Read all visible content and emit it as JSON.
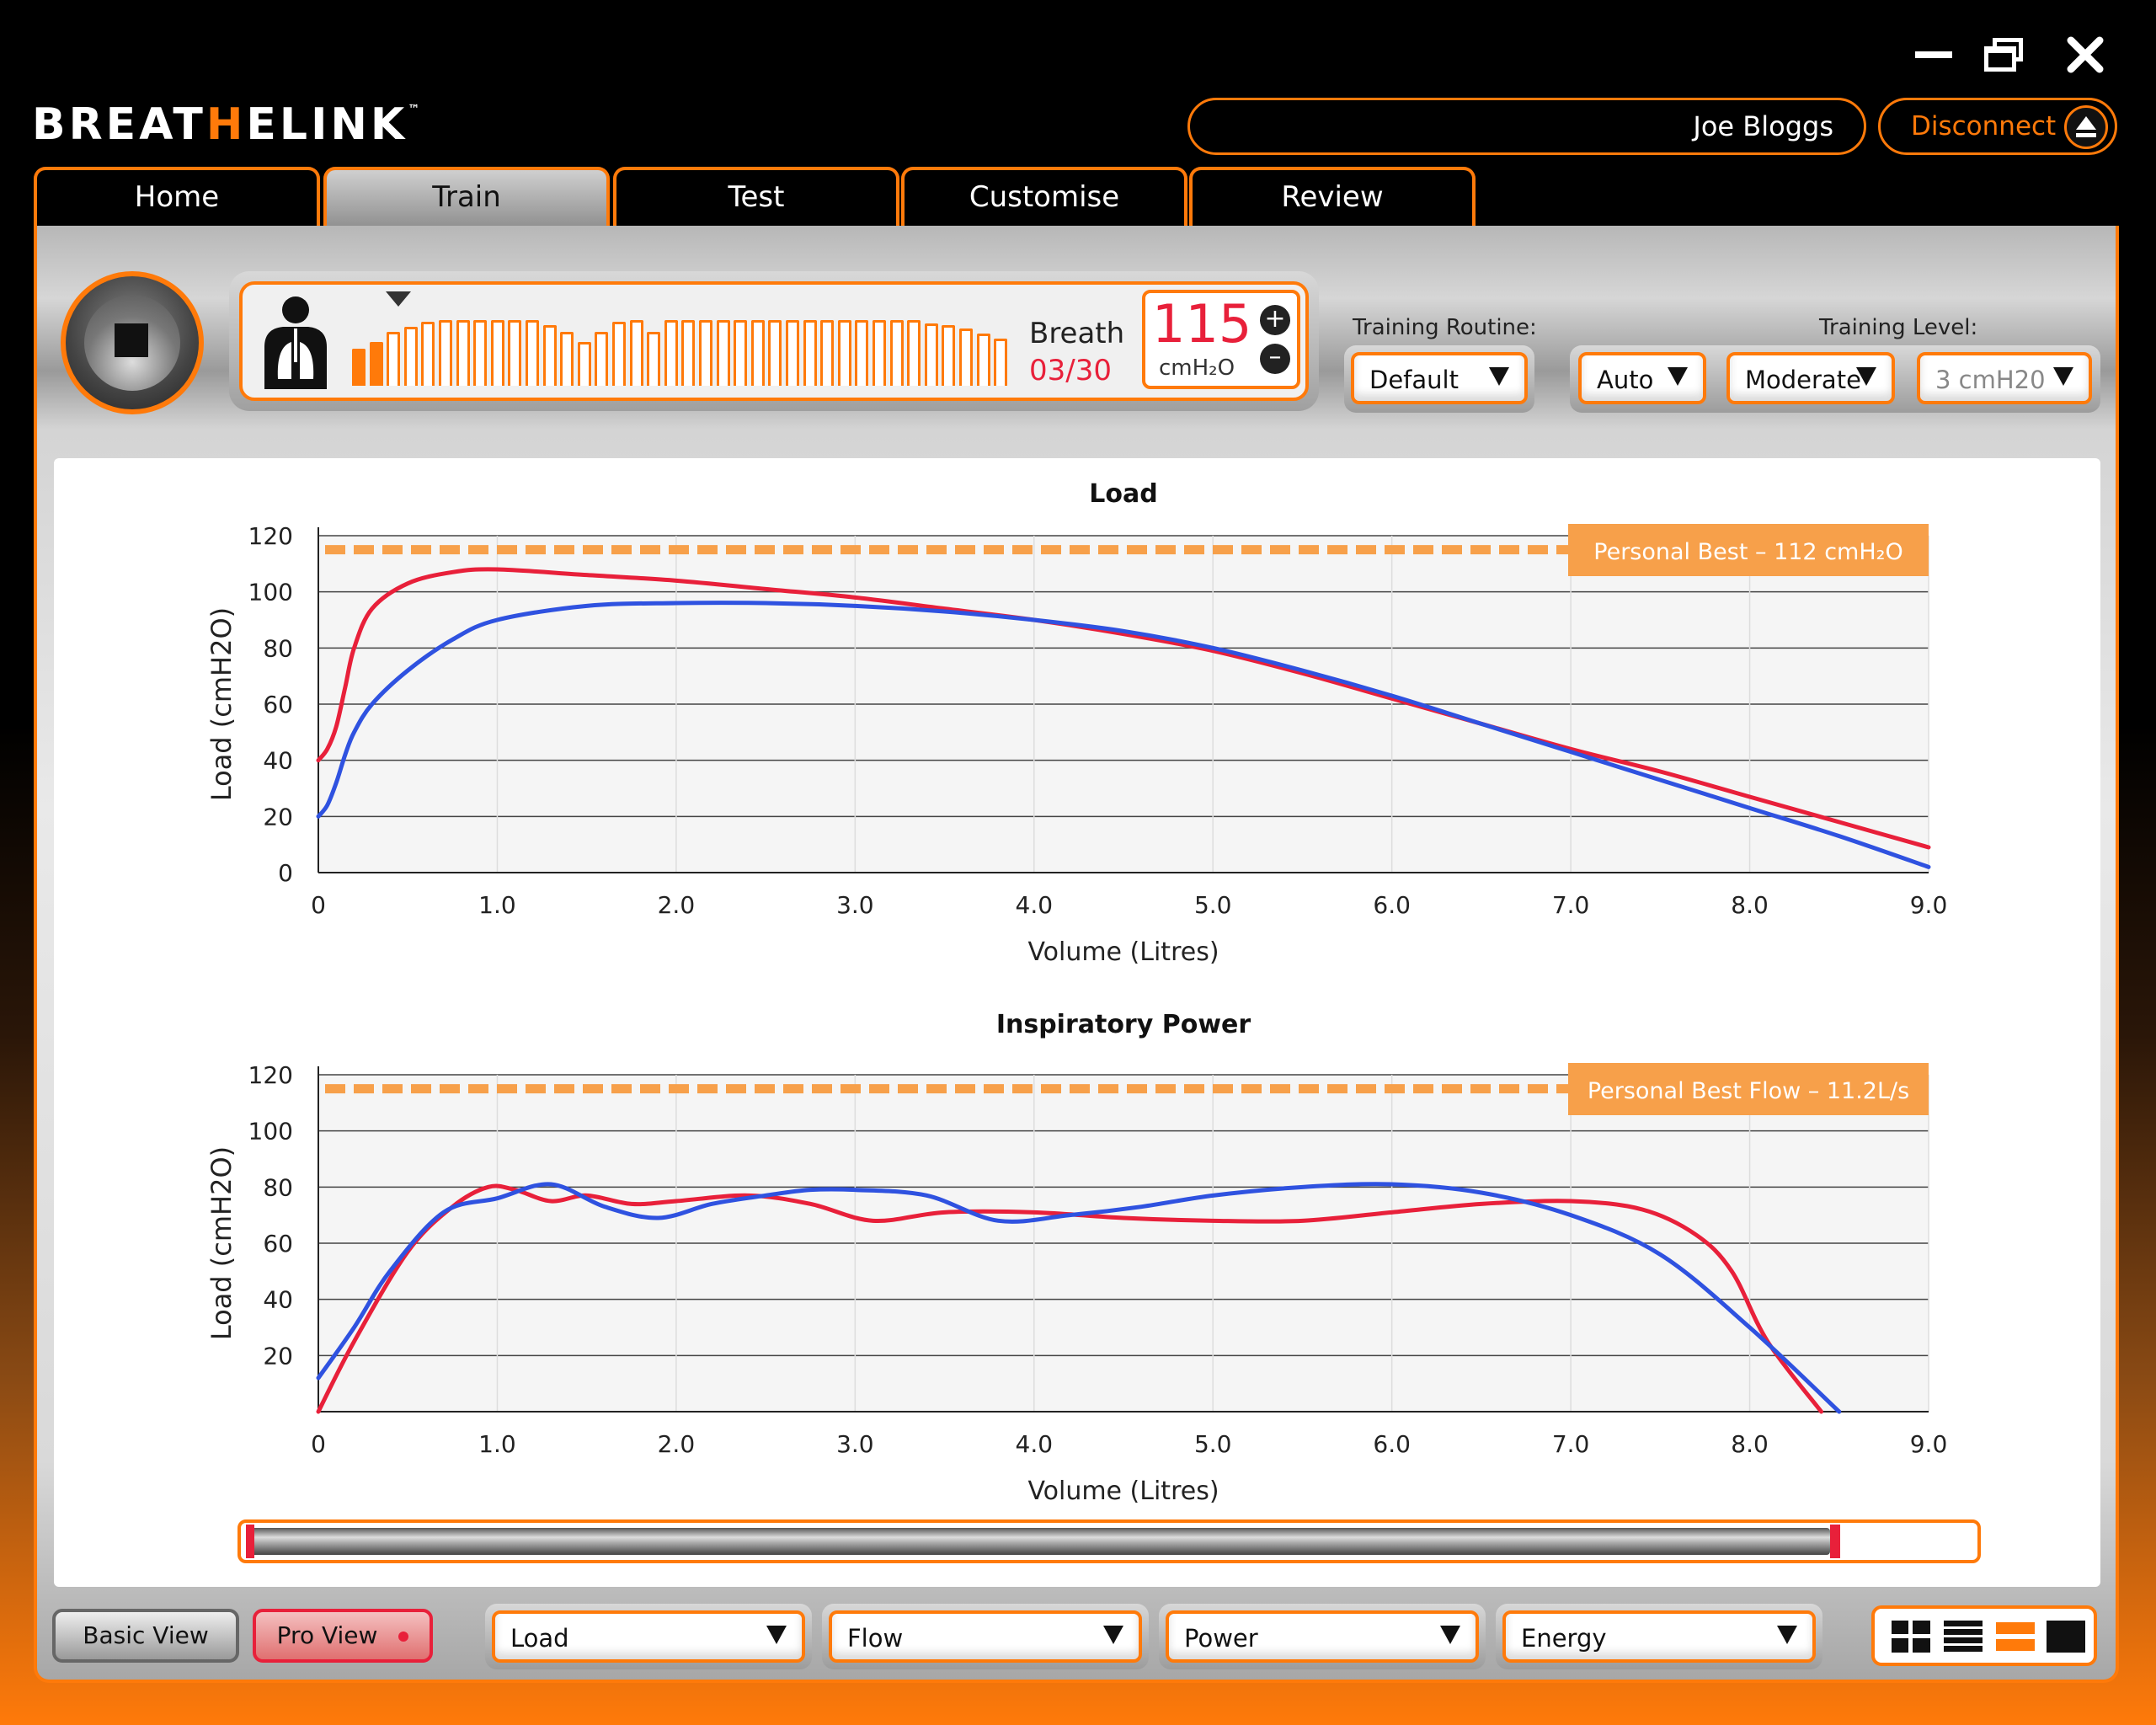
{
  "brand": {
    "name_left": "BREAT",
    "name_accent": "H",
    "name_right": "ELINK",
    "tm": "™"
  },
  "user": {
    "name": "Joe Bloggs"
  },
  "disconnect": {
    "label": "Disconnect"
  },
  "tabs": [
    {
      "label": "Home"
    },
    {
      "label": "Train"
    },
    {
      "label": "Test"
    },
    {
      "label": "Customise"
    },
    {
      "label": "Review"
    }
  ],
  "active_tab": "Train",
  "breath": {
    "label": "Breath",
    "count": "03/30",
    "filled_bars": 2
  },
  "pressure": {
    "value": "115",
    "unit": "cmH₂O"
  },
  "training_routine": {
    "label": "Training Routine:",
    "value": "Default"
  },
  "training_level": {
    "label": "Training Level:",
    "mode": "Auto",
    "level": "Moderate",
    "step": "3 cmH20"
  },
  "colors": {
    "accent": "#ff7a0a",
    "series_red": "#e8203a",
    "series_blue": "#2f52e0",
    "best_line": "#f7a04a"
  },
  "chart_data": [
    {
      "type": "line",
      "title": "Load",
      "xlabel": "Volume (Litres)",
      "ylabel": "Load (cmH2O)",
      "xlim": [
        0,
        9
      ],
      "ylim": [
        0,
        120
      ],
      "xticks": [
        "0",
        "1.0",
        "2.0",
        "3.0",
        "4.0",
        "5.0",
        "6.0",
        "7.0",
        "8.0",
        "9.0"
      ],
      "yticks": [
        "0",
        "20",
        "40",
        "60",
        "80",
        "100",
        "120"
      ],
      "reference_line": {
        "label": "Personal Best – 112 cmH₂O",
        "y": 115
      },
      "series": [
        {
          "color": "#e8203a",
          "x": [
            0,
            0.05,
            0.1,
            0.15,
            0.2,
            0.3,
            0.5,
            0.75,
            1.0,
            1.5,
            2.0,
            2.5,
            3.0,
            3.5,
            4.0,
            4.5,
            5.0,
            5.5,
            6.0,
            6.5,
            7.0,
            7.5,
            8.0,
            8.5,
            9.0
          ],
          "y": [
            40,
            44,
            52,
            66,
            80,
            94,
            103,
            107,
            108,
            106,
            104,
            101,
            98,
            94,
            90,
            85,
            79,
            71,
            62,
            53,
            44,
            36,
            27,
            18,
            9
          ]
        },
        {
          "color": "#2f52e0",
          "x": [
            0,
            0.05,
            0.1,
            0.15,
            0.2,
            0.3,
            0.5,
            0.75,
            1.0,
            1.5,
            2.0,
            2.5,
            3.0,
            3.5,
            4.0,
            4.5,
            5.0,
            5.5,
            6.0,
            6.5,
            7.0,
            7.5,
            8.0,
            8.5,
            9.0
          ],
          "y": [
            20,
            24,
            32,
            42,
            50,
            60,
            72,
            83,
            90,
            95,
            96,
            96,
            95,
            93,
            90,
            86,
            80,
            72,
            63,
            53,
            43,
            33,
            23,
            13,
            2
          ]
        }
      ]
    },
    {
      "type": "line",
      "title": "Inspiratory Power",
      "xlabel": "Volume (Litres)",
      "ylabel": "Load (cmH2O)",
      "xlim": [
        0,
        9
      ],
      "ylim": [
        0,
        120
      ],
      "xticks": [
        "0",
        "1.0",
        "2.0",
        "3.0",
        "4.0",
        "5.0",
        "6.0",
        "7.0",
        "8.0",
        "9.0"
      ],
      "yticks": [
        "20",
        "40",
        "60",
        "80",
        "100",
        "120"
      ],
      "reference_line": {
        "label": "Personal Best Flow – 11.2L/s",
        "y": 115
      },
      "series": [
        {
          "color": "#e8203a",
          "x": [
            0,
            0.2,
            0.5,
            0.75,
            0.95,
            1.1,
            1.3,
            1.5,
            1.75,
            2.0,
            2.4,
            2.75,
            3.1,
            3.5,
            4.0,
            4.5,
            5.0,
            5.5,
            6.0,
            6.5,
            7.0,
            7.4,
            7.7,
            7.9,
            8.1,
            8.4
          ],
          "y": [
            0,
            25,
            57,
            73,
            80,
            79,
            75,
            77,
            74,
            75,
            77,
            74,
            68,
            71,
            71,
            69,
            68,
            68,
            71,
            74,
            75,
            72,
            63,
            50,
            25,
            0
          ]
        },
        {
          "color": "#2f52e0",
          "x": [
            0,
            0.2,
            0.4,
            0.7,
            1.0,
            1.3,
            1.6,
            1.9,
            2.2,
            2.5,
            2.75,
            3.0,
            3.4,
            3.8,
            4.2,
            4.6,
            5.0,
            5.5,
            6.0,
            6.5,
            7.0,
            7.5,
            8.0,
            8.5
          ],
          "y": [
            12,
            30,
            50,
            71,
            76,
            81,
            73,
            69,
            74,
            77,
            79,
            79,
            77,
            68,
            70,
            73,
            77,
            80,
            81,
            78,
            70,
            56,
            30,
            0
          ]
        }
      ]
    }
  ],
  "scrubber": {
    "position": 0.92
  },
  "view_buttons": {
    "basic": "Basic View",
    "pro": "Pro View"
  },
  "channel_selectors": [
    "Load",
    "Flow",
    "Power",
    "Energy"
  ]
}
